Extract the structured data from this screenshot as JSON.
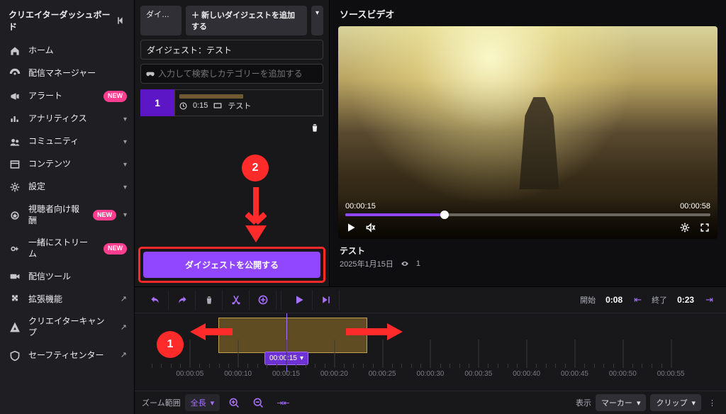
{
  "sidebar": {
    "title": "クリエイターダッシュボード",
    "items": [
      {
        "icon": "home",
        "label": "ホーム"
      },
      {
        "icon": "broadcast",
        "label": "配信マネージャー"
      },
      {
        "icon": "megaphone",
        "label": "アラート",
        "badge": "NEW"
      },
      {
        "icon": "analytics",
        "label": "アナリティクス",
        "caret": true
      },
      {
        "icon": "community",
        "label": "コミュニティ",
        "caret": true
      },
      {
        "icon": "content",
        "label": "コンテンツ",
        "caret": true
      },
      {
        "icon": "gear",
        "label": "設定",
        "caret": true
      },
      {
        "icon": "reward",
        "label": "視聴者向け報酬",
        "badge": "NEW",
        "caret": true
      },
      {
        "icon": "together",
        "label": "一緒にストリーム",
        "badge": "NEW"
      },
      {
        "icon": "camera",
        "label": "配信ツール"
      },
      {
        "icon": "puzzle",
        "label": "拡張機能",
        "ext": true
      },
      {
        "icon": "camp",
        "label": "クリエイターキャンプ",
        "ext": true
      },
      {
        "icon": "shield",
        "label": "セーフティセンター",
        "ext": true
      }
    ]
  },
  "digest": {
    "tab_label": "ダイジェ…",
    "add_button": "＋ 新しいダイジェストを追加する",
    "title_value": "ダイジェスト：テスト",
    "search_placeholder": "入力して検索しカテゴリーを追加する",
    "clip": {
      "num": "1",
      "dur": "0:15",
      "name": "テスト"
    },
    "publish": "ダイジェストを公開する"
  },
  "video": {
    "heading": "ソースビデオ",
    "time_cur": "00:00:15",
    "time_total": "00:00:58",
    "title": "テスト",
    "date": "2025年1月15日",
    "views": "1"
  },
  "timeline": {
    "start_label": "開始",
    "start_val": "0:08",
    "end_label": "終了",
    "end_val": "0:23",
    "playhead": "00:00:15",
    "ticks": [
      "00:00:05",
      "00:00:10",
      "00:00:15",
      "00:00:20",
      "00:00:25",
      "00:00:30",
      "00:00:35",
      "00:00:40",
      "00:00:45",
      "00:00:50",
      "00:00:55"
    ],
    "zoom_label": "ズーム範囲",
    "zoom_value": "全長",
    "show_label": "表示",
    "marker_label": "マーカー",
    "clip_label": "クリップ"
  },
  "anno": {
    "one": "1",
    "two": "2"
  }
}
